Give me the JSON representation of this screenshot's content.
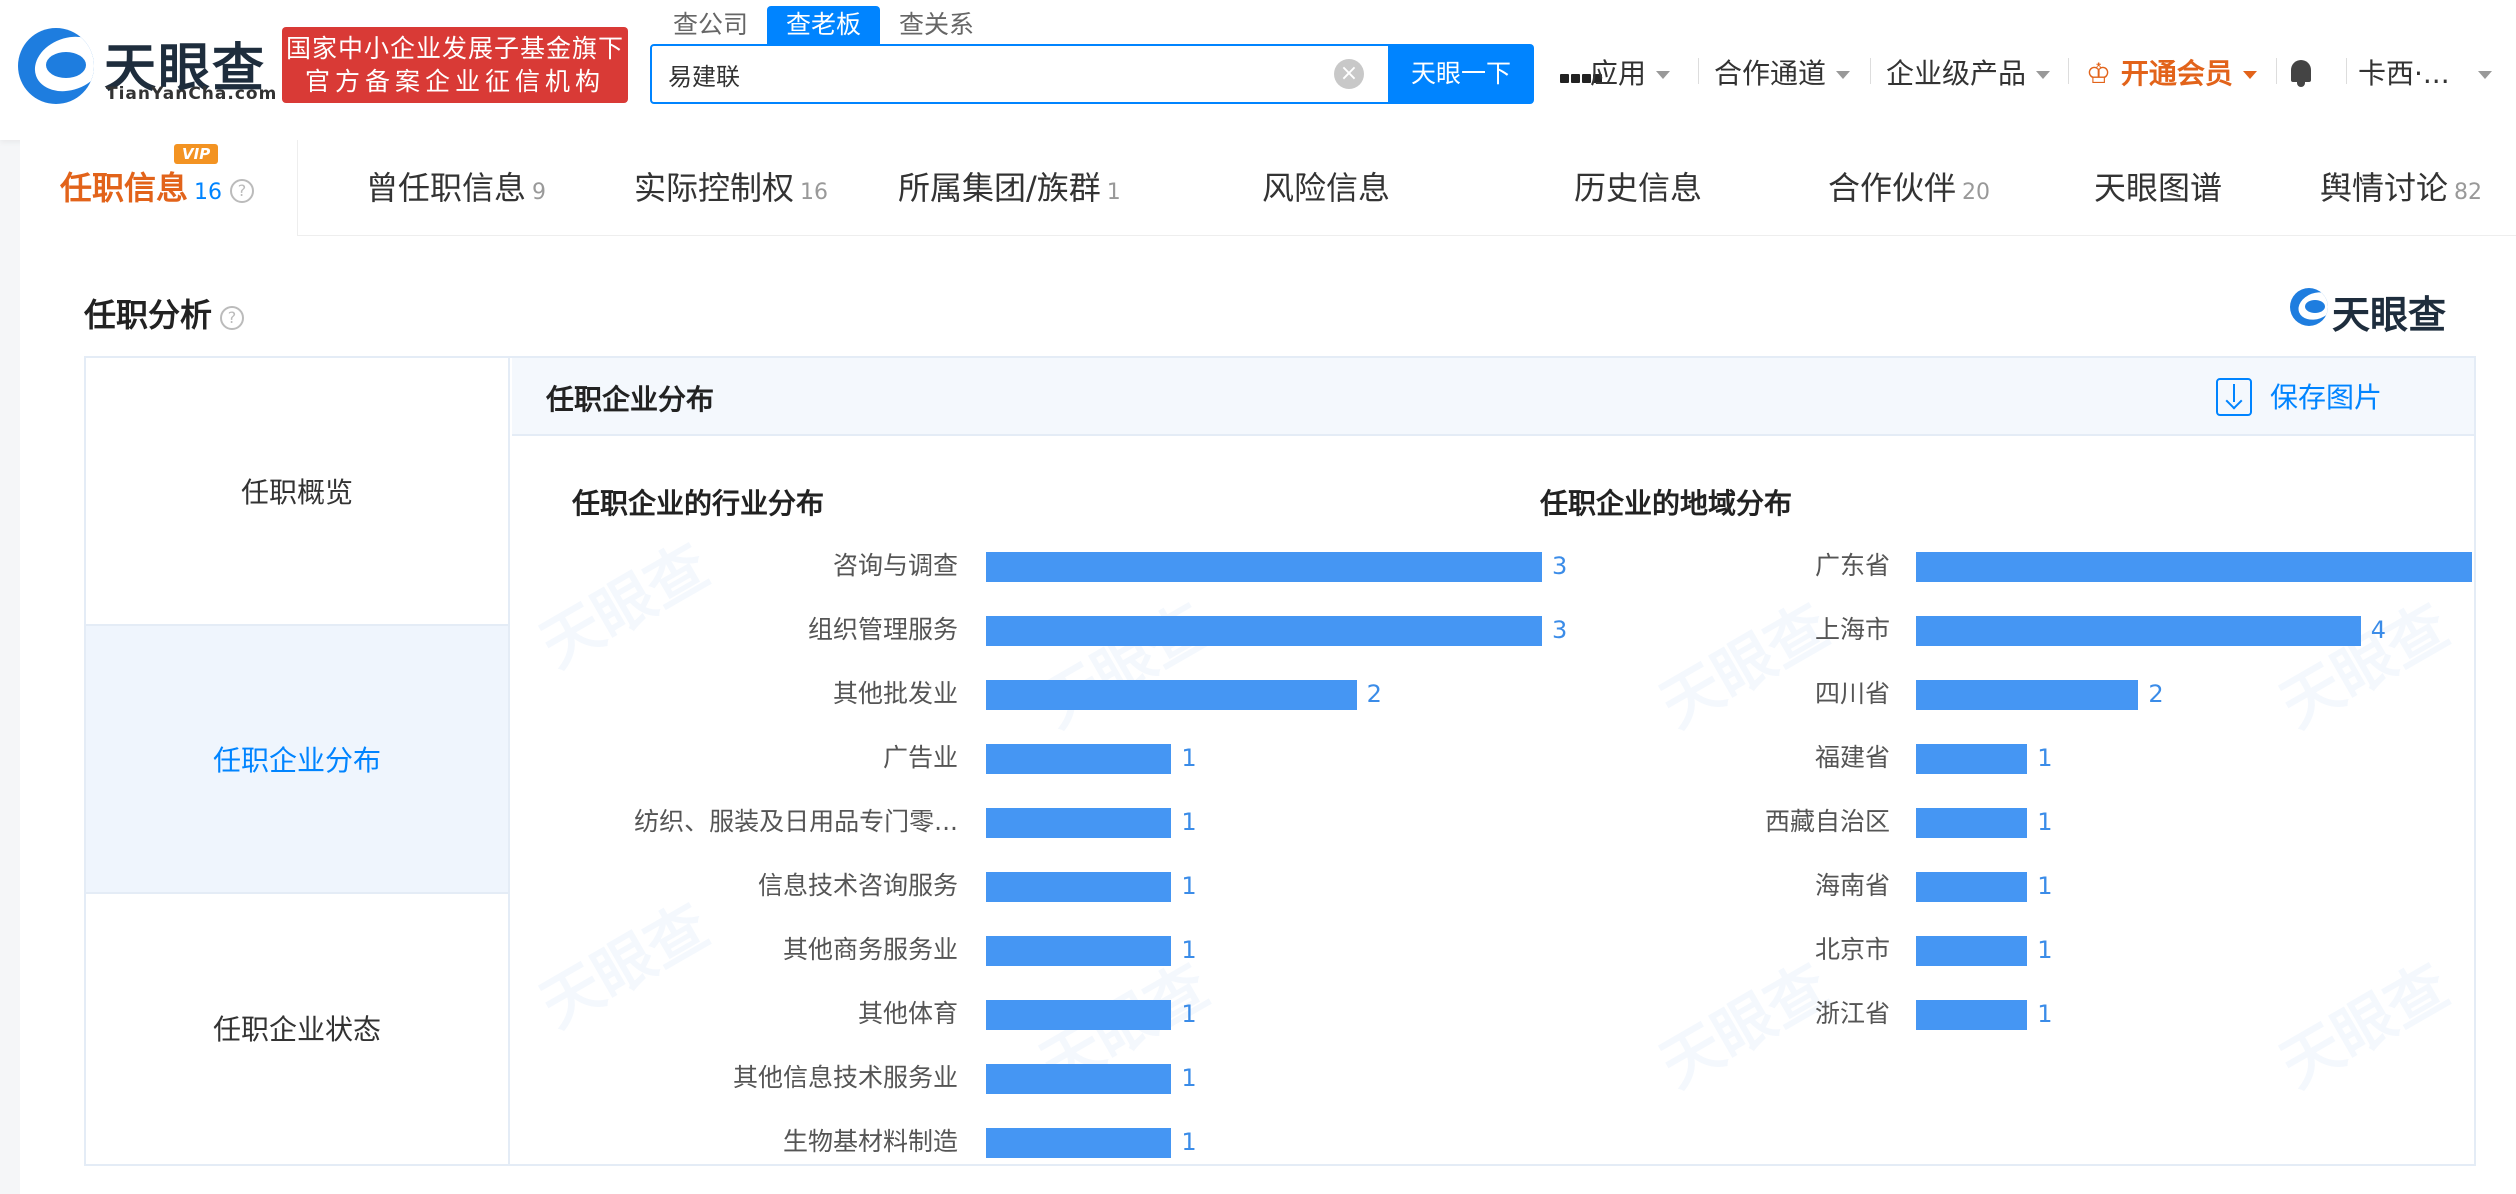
{
  "header": {
    "logo_text": "天眼查",
    "logo_sub": "TianYanCha.com",
    "gov_badge_line1": "国家中小企业发展子基金旗下",
    "gov_badge_line2": "官方备案企业征信机构",
    "search_tabs": [
      "查公司",
      "查老板",
      "查关系"
    ],
    "search_value": "易建联",
    "search_button": "天眼一下",
    "nav": {
      "apps": "应用",
      "partner": "合作通道",
      "enterprise": "企业级产品",
      "vip": "开通会员",
      "user": "卡西·..."
    }
  },
  "tabs": [
    {
      "label": "任职信息",
      "count": "16"
    },
    {
      "label": "曾任职信息",
      "count": "9"
    },
    {
      "label": "实际控制权",
      "count": "16"
    },
    {
      "label": "所属集团/族群",
      "count": "1"
    },
    {
      "label": "风险信息",
      "count": ""
    },
    {
      "label": "历史信息",
      "count": ""
    },
    {
      "label": "合作伙伴",
      "count": "20"
    },
    {
      "label": "天眼图谱",
      "count": ""
    },
    {
      "label": "舆情讨论",
      "count": "82"
    }
  ],
  "vip_tag": "VIP",
  "section": {
    "title": "任职分析",
    "brand": "天眼查"
  },
  "side_menu": [
    "任职概览",
    "任职企业分布",
    "任职企业状态"
  ],
  "panel": {
    "title": "任职企业分布",
    "save_label": "保存图片"
  },
  "watermark": "天眼查",
  "chart_data": [
    {
      "type": "bar",
      "orientation": "horizontal",
      "title": "任职企业的行业分布",
      "categories": [
        "咨询与调查",
        "组织管理服务",
        "其他批发业",
        "广告业",
        "纺织、服装及日用品专门零...",
        "信息技术咨询服务",
        "其他商务服务业",
        "其他体育",
        "其他信息技术服务业",
        "生物基材料制造"
      ],
      "values": [
        3,
        3,
        2,
        1,
        1,
        1,
        1,
        1,
        1,
        1
      ],
      "xlim": [
        0,
        3
      ],
      "color": "#4596f3"
    },
    {
      "type": "bar",
      "orientation": "horizontal",
      "title": "任职企业的地域分布",
      "categories": [
        "广东省",
        "上海市",
        "四川省",
        "福建省",
        "西藏自治区",
        "海南省",
        "北京市",
        "浙江省"
      ],
      "values": [
        5,
        4,
        2,
        1,
        1,
        1,
        1,
        1
      ],
      "xlim": [
        0,
        5
      ],
      "color": "#4596f3"
    }
  ]
}
